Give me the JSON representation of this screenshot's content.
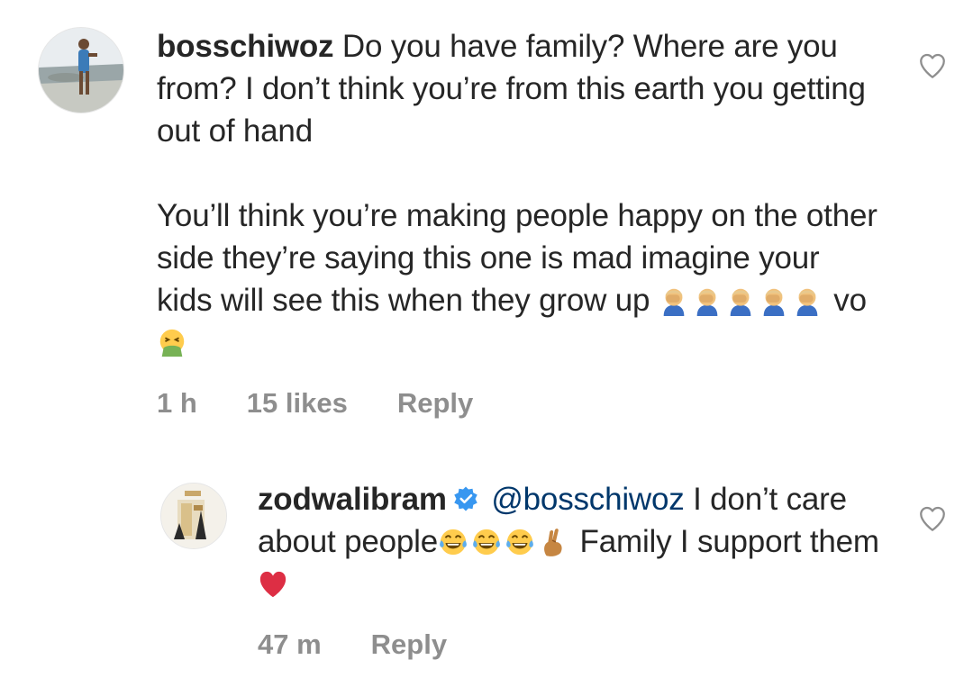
{
  "comments": [
    {
      "username": "bosschiwoz",
      "text_part1": "Do you have family? Where are you from? I don’t think you’re from this earth you getting out of hand",
      "text_part2": "You’ll think you’re making people happy on the other side they’re saying this one is mad imagine your kids will see this when they grow up",
      "emoji_facepalm": "man-facepalming-emoji",
      "text_tail": "vo",
      "emoji_vomit": "face-vomiting-emoji",
      "time": "1 h",
      "likes": "15 likes",
      "reply_label": "Reply",
      "avatar_icon": "user-avatar-photo",
      "like_icon": "heart-outline-icon"
    },
    {
      "username": "zodwalibram",
      "verified_icon": "verified-badge-icon",
      "mention": "@bosschiwoz",
      "text_part1": "I don’t care about people",
      "emoji_laugh": "face-with-tears-of-joy-emoji",
      "emoji_fingers": "crossed-fingers-emoji",
      "text_part2": "Family I support them",
      "emoji_heart": "red-heart-emoji",
      "time": "47 m",
      "reply_label": "Reply",
      "avatar_icon": "product-avatar-image",
      "like_icon": "heart-outline-icon"
    }
  ],
  "colors": {
    "text": "#262626",
    "meta": "#8e8e8e",
    "mention": "#00376b",
    "verified": "#3897f0"
  }
}
